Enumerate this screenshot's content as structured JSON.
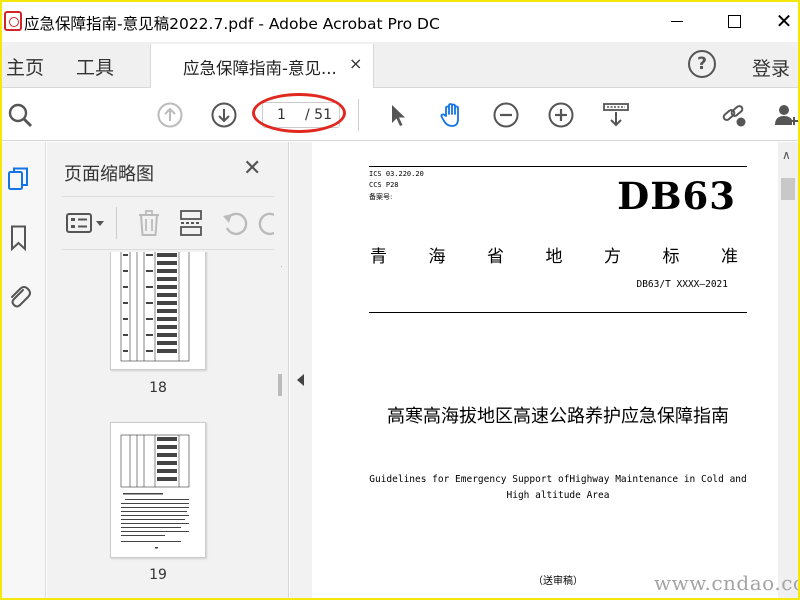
{
  "window": {
    "title": "应急保障指南-意见稿2022.7.pdf - Adobe Acrobat Pro DC",
    "icon": "acrobat-icon"
  },
  "tabs": {
    "home": "主页",
    "tools": "工具",
    "document_tab": "应急保障指南-意见...",
    "close": "×",
    "login": "登录"
  },
  "toolbar": {
    "page_current": "1",
    "page_total": "/ 51",
    "highlight_color": "#e0281e"
  },
  "panel": {
    "title": "页面缩略图",
    "close": "✕",
    "thumbnails": [
      {
        "label": "18"
      },
      {
        "label": "19"
      }
    ]
  },
  "document": {
    "ics": "ICS 03.220.20",
    "ccs": "CCS P28",
    "record": "备案号:",
    "code": "DB63",
    "std_type_chars": [
      "青",
      "海",
      "省",
      "地",
      "方",
      "标",
      "准"
    ],
    "std_no": "DB63/T XXXX—2021",
    "title_cn": "高寒高海拔地区高速公路养护应急保障指南",
    "title_en": "Guidelines for Emergency Support ofHighway Maintenance in Cold and High altitude Area",
    "draft": "（送审稿）"
  },
  "watermark": "www.cndao.com",
  "colors": {
    "border_yellow": "#f4e80a",
    "accent_blue": "#1473e6"
  }
}
